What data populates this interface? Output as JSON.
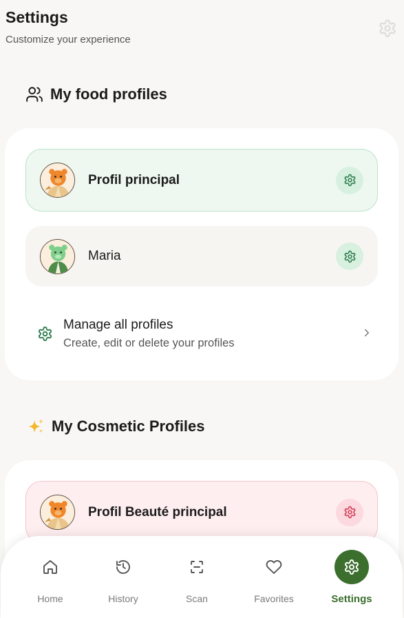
{
  "header": {
    "title": "Settings",
    "subtitle": "Customize your experience",
    "icon": "gear-icon"
  },
  "food_section": {
    "title": "My food profiles",
    "icon": "users-icon",
    "profiles": [
      {
        "name": "Profil principal",
        "active": true,
        "avatar": "bear-avatar",
        "action_icon": "gear-icon"
      },
      {
        "name": "Maria",
        "active": false,
        "avatar": "bear-avatar",
        "action_icon": "gear-icon"
      }
    ],
    "manage": {
      "title": "Manage all profiles",
      "subtitle": "Create, edit or delete your profiles",
      "icon": "gear-icon",
      "chevron": "chevron-right-icon"
    }
  },
  "cosmetic_section": {
    "title": "My Cosmetic Profiles",
    "icon": "sparkles-icon",
    "profiles": [
      {
        "name": "Profil Beauté principal",
        "active": true,
        "avatar": "bear-avatar",
        "action_icon": "gear-icon"
      }
    ]
  },
  "tabbar": {
    "active": "Settings",
    "items": [
      {
        "label": "Home",
        "icon": "home-icon"
      },
      {
        "label": "History",
        "icon": "history-icon"
      },
      {
        "label": "Scan",
        "icon": "scan-icon"
      },
      {
        "label": "Favorites",
        "icon": "heart-icon"
      },
      {
        "label": "Settings",
        "icon": "gear-icon"
      }
    ]
  },
  "colors": {
    "brand": "#3c6e2e",
    "food_accent": "#2e7d4f",
    "beauty_accent": "#d23a55",
    "background": "#f8f7f5"
  }
}
